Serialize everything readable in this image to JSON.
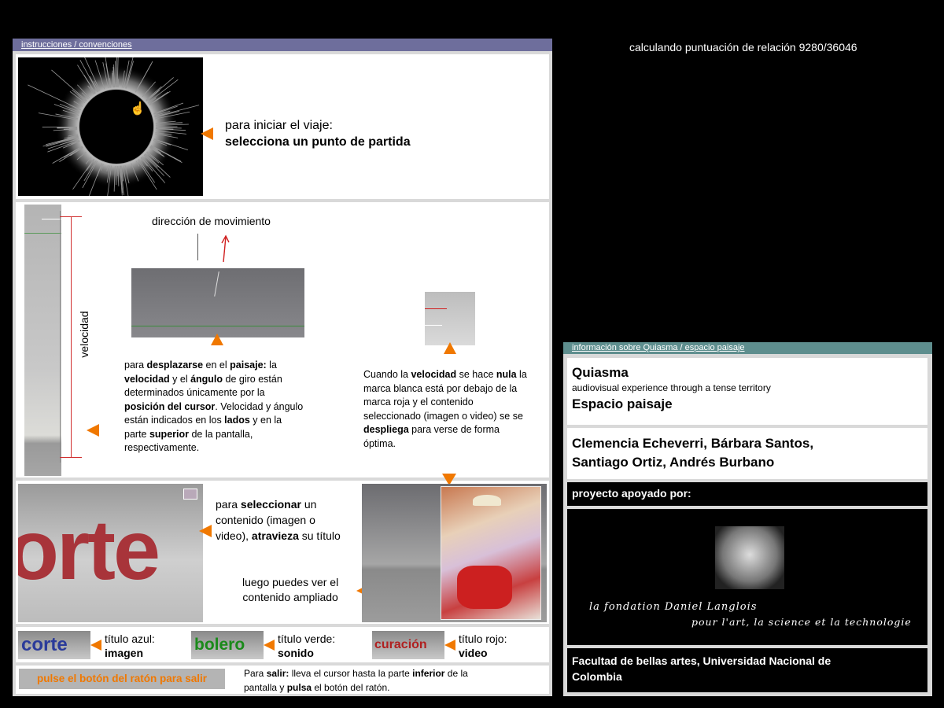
{
  "status_text": "calculando puntuación de relación 9280/36046",
  "instructions": {
    "header": "instrucciones / convenciones",
    "start": {
      "line1": "para iniciar el viaje:",
      "line2": "selecciona un punto de partida"
    },
    "movement": {
      "direction_label": "dirección de movimiento",
      "velocity_label": "velocidad",
      "desc_parts": [
        "para ",
        "desplazarse",
        " en el ",
        "paisaje:",
        " la ",
        "velocidad",
        " y el ",
        "ángulo",
        " de giro están determinados únicamente por la ",
        "posición del cursor",
        ". Velocidad y ángulo están indicados en los ",
        "lados",
        " y en la parte ",
        "superior",
        " de la pantalla, respectivamente."
      ],
      "null_parts": [
        "Cuando la ",
        "velocidad",
        " se hace ",
        "nula",
        " la marca blanca está por debajo de la marca roja y el contenido seleccionado (imagen o video) se se ",
        "despliega",
        " para verse de forma óptima."
      ]
    },
    "select": {
      "big_word": "orte",
      "parts": [
        "para ",
        "seleccionar",
        " un contenido (imagen o video), ",
        "atravieza",
        " su título"
      ],
      "then_line1": "luego puedes ver el",
      "then_line2": "contenido ampliado"
    },
    "legend": [
      {
        "word": "corte",
        "label": "título azul:",
        "value": "imagen",
        "color": "#2a3a9a"
      },
      {
        "word": "bolero",
        "label": "título verde:",
        "value": "sonido",
        "color": "#1a8a1a"
      },
      {
        "word": "curación",
        "label": "título rojo:",
        "value": "video",
        "color": "#b02020"
      }
    ],
    "exit": {
      "button_label": "pulse el botón del ratón para salir",
      "parts": [
        "Para ",
        "salir:",
        " lleva el cursor hasta la parte ",
        "inferior",
        " de la pantalla y ",
        "pulsa",
        " el botón del ratón."
      ]
    }
  },
  "info": {
    "header": "información sobre Quiasma / espacio paisaje",
    "title": "Quiasma",
    "subtitle": "audiovisual experience through a tense territory",
    "section": "Espacio paisaje",
    "authors": "Clemencia Echeverri, Bárbara Santos, Santiago Ortiz, Andrés Burbano",
    "supported_by": "proyecto apoyado por:",
    "foundation_line1": "la fondation Daniel Langlois",
    "foundation_line2": "pour l'art, la science et la technologie",
    "faculty": "Facultad de bellas artes, Universidad Nacional de Colombia"
  }
}
